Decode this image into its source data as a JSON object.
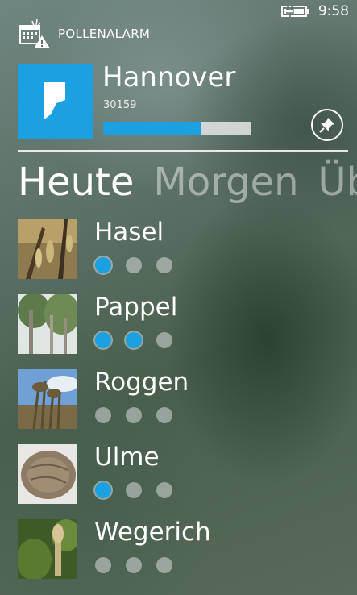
{
  "status_bar": {
    "time": "9:58",
    "battery_icon": "battery-charging-icon"
  },
  "app": {
    "name": "POLLENALARM",
    "logo_icon": "calendar-warning-icon"
  },
  "location": {
    "city": "Hannover",
    "zip": "30159",
    "level_fraction": 0.66,
    "tile_color": "#1ba1e2",
    "pin_icon": "pin-icon"
  },
  "pivot": {
    "tabs": [
      {
        "label": "Heute",
        "active": true
      },
      {
        "label": "Morgen",
        "active": false
      },
      {
        "label": "Üb",
        "active": false
      }
    ]
  },
  "plants": [
    {
      "name": "Hasel",
      "level": 1,
      "image": "hazel-catkins"
    },
    {
      "name": "Pappel",
      "level": 2,
      "image": "poplar-trees"
    },
    {
      "name": "Roggen",
      "level": 0,
      "image": "rye-grass"
    },
    {
      "name": "Ulme",
      "level": 1,
      "image": "elm-seed"
    },
    {
      "name": "Wegerich",
      "level": 0,
      "image": "plantain-flower"
    }
  ],
  "colors": {
    "accent": "#1ba1e2",
    "dot_inactive": "#d7dcda"
  }
}
